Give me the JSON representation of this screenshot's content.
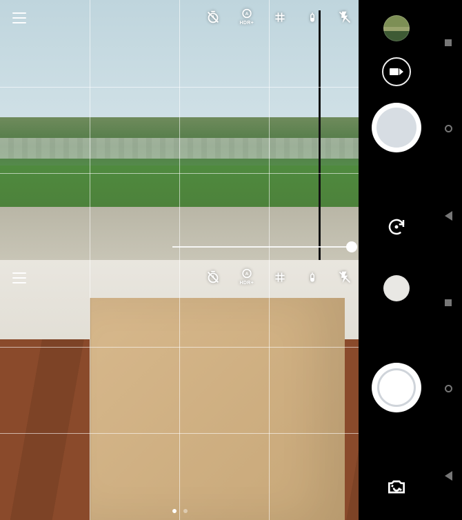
{
  "shots": [
    {
      "hdr_label": "HDR+",
      "icons": {
        "timer": "timer-off-icon",
        "hdr": "hdr-auto-icon",
        "grid": "grid-icon",
        "wb": "white-balance-icon",
        "flash": "flash-off-icon"
      }
    },
    {
      "hdr_label": "HDR+",
      "icons": {
        "timer": "timer-off-icon",
        "hdr": "hdr-auto-icon",
        "grid": "grid-icon",
        "wb": "white-balance-icon",
        "flash": "flash-off-icon"
      }
    }
  ]
}
